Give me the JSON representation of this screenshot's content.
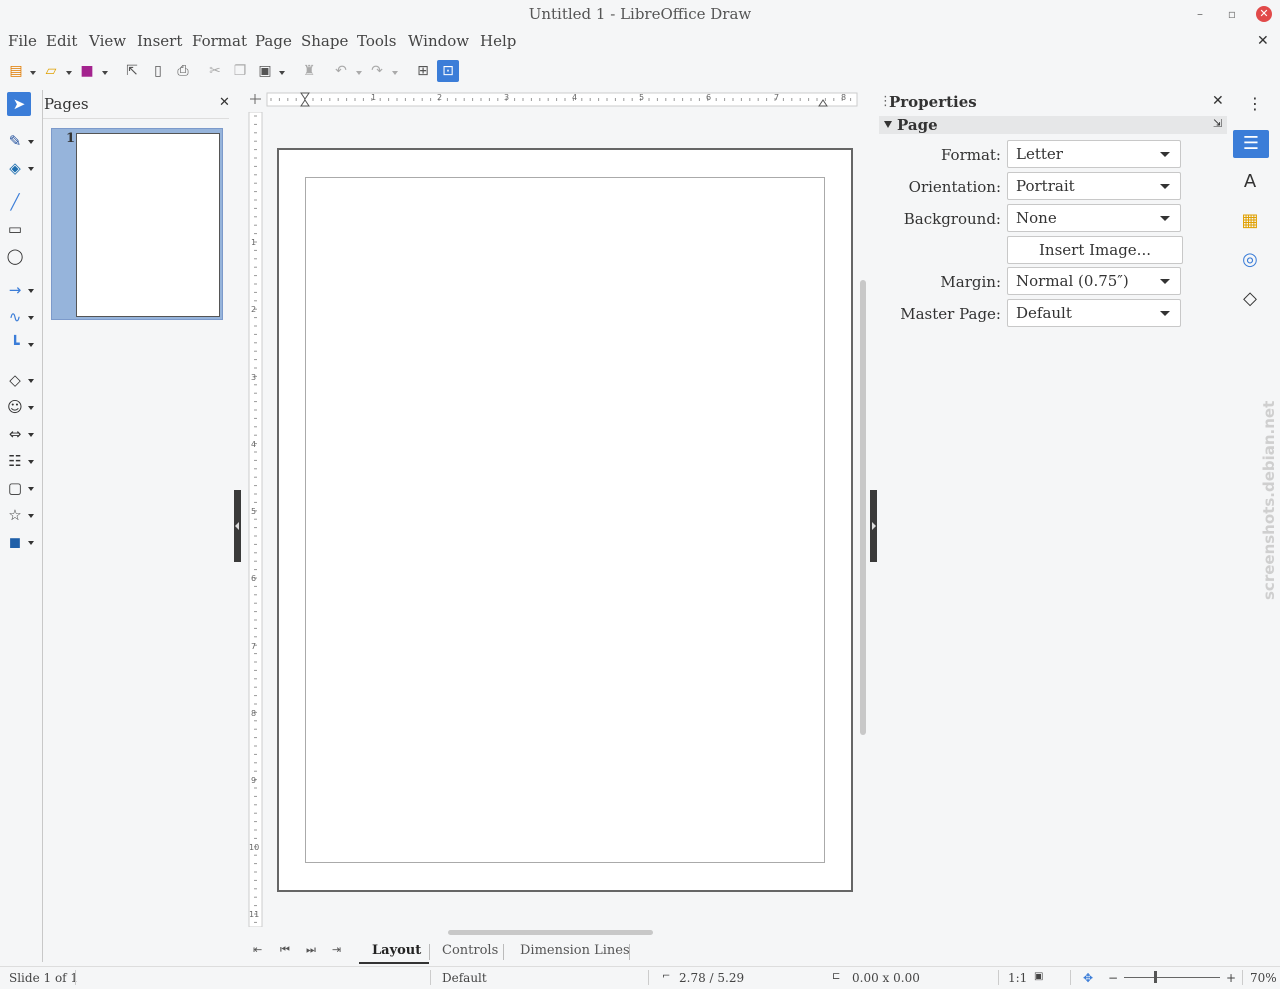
{
  "window": {
    "title": "Untitled 1 - LibreOffice Draw",
    "minimize": "–",
    "restore": "▫",
    "close": "✕",
    "doc_close": "✕"
  },
  "menu": [
    "File",
    "Edit",
    "View",
    "Insert",
    "Format",
    "Page",
    "Shape",
    "Tools",
    "Window",
    "Help"
  ],
  "toolbar_icons": [
    "new-icon",
    "open-icon",
    "save-icon",
    "export-icon",
    "export-pdf-icon",
    "print-icon",
    "cut-icon",
    "copy-icon",
    "paste-icon",
    "clone-formatting-icon",
    "undo-icon",
    "redo-icon",
    "grid-icon",
    "helplines-icon"
  ],
  "drawing_tools": [
    "select-icon",
    "line-color-icon",
    "fill-color-icon",
    "line-icon",
    "rectangle-icon",
    "ellipse-icon",
    "arrow-line-icon",
    "curve-icon",
    "connector-icon",
    "basic-shapes-icon",
    "symbol-shapes-icon",
    "block-arrows-icon",
    "flowchart-icon",
    "callouts-icon",
    "stars-icon",
    "3d-objects-icon"
  ],
  "pages_pane": {
    "title": "Pages",
    "close": "✕",
    "page_number": "1"
  },
  "ruler": {
    "h_numbers": [
      "1",
      "2",
      "3",
      "4",
      "5",
      "6",
      "7",
      "8"
    ],
    "v_numbers": [
      "1",
      "2",
      "3",
      "4",
      "5",
      "6",
      "7",
      "8",
      "9",
      "10",
      "11"
    ]
  },
  "layer_tabs": [
    "Layout",
    "Controls",
    "Dimension Lines"
  ],
  "properties": {
    "title": "Properties",
    "close": "✕",
    "section": "Page",
    "format_label": "Format:",
    "format_value": "Letter",
    "orientation_label": "Orientation:",
    "orientation_value": "Portrait",
    "background_label": "Background:",
    "background_value": "None",
    "insert_image": "Insert Image...",
    "margin_label": "Margin:",
    "margin_value": "Normal (0.75″)",
    "master_label": "Master Page:",
    "master_value": "Default"
  },
  "deck_icons": [
    "properties-icon",
    "styles-icon",
    "gallery-icon",
    "navigator-icon",
    "shapes-icon"
  ],
  "watermark": "screenshots.debian.net",
  "status": {
    "slide": "Slide 1 of 1",
    "master": "Default",
    "position": "2.78 / 5.29",
    "size": "0.00 x 0.00",
    "scale": "1:1",
    "zoom": "70%"
  },
  "colors": {
    "accent": "#3b7dd8",
    "page_selected": "#96b4db"
  }
}
